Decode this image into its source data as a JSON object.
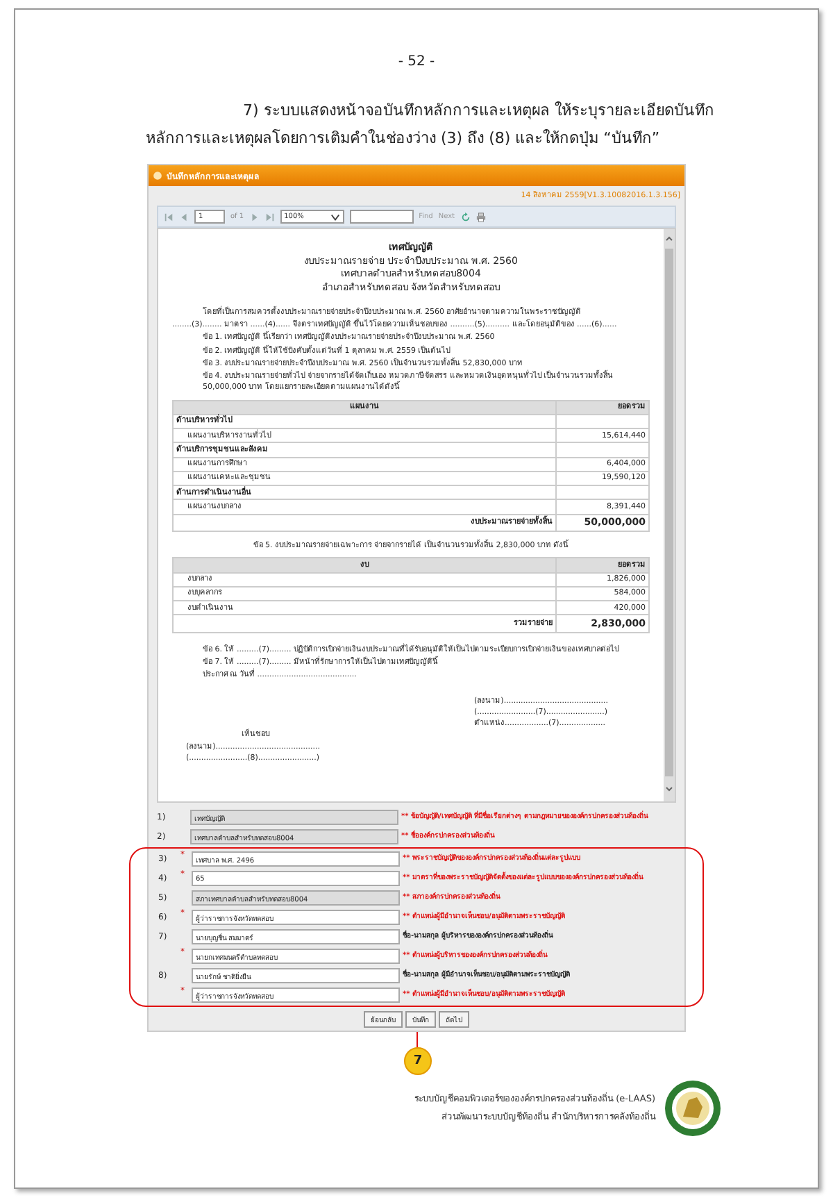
{
  "page_number": "- 52 -",
  "instruction": "7)  ระบบแสดงหน้าจอบันทึกหลักการและเหตุผล ให้ระบุรายละเอียดบันทึกหลักการและเหตุผลโดยการเติมคำในช่องว่าง (3) ถึง (8) และให้กดปุ่ม “บันทึก”",
  "panel": {
    "title": "บันทึกหลักการและเหตุผล",
    "version": "14 สิงหาคม 2559[V1.3.10082016.1.3.156]"
  },
  "viewer": {
    "page": "1",
    "of": "of 1",
    "zoom": "100%",
    "find": "Find",
    "next": "Next"
  },
  "report": {
    "title": "เทศบัญญัติ",
    "subtitles": [
      "งบประมาณรายจ่าย ประจำปีงบประมาณ พ.ศ. 2560",
      "เทศบาลตำบลสำหรับทดสอบ8004",
      "อำเภอสำหรับทดสอบ จังหวัดสำหรับทดสอบ"
    ],
    "preamble": "โดยที่เป็นการสมควรตั้งงบประมาณรายจ่ายประจำปีงบประมาณ พ.ศ. 2560 อาศัยอำนาจตามความในพระราชบัญญัติ",
    "blank_line": "........(3)........ มาตรา ......(4)...... จึงตราเทศบัญญัติ ขึ้นไว้โดยความเห็นชอบของ ..........(5).......... และโดยอนุมัติของ ......(6)......",
    "clauses": [
      "ข้อ 1. เทศบัญญัติ นี้เรียกว่า เทศบัญญัติงบประมาณรายจ่ายประจำปีงบประมาณ พ.ศ. 2560",
      "ข้อ 2. เทศบัญญัติ นี้ให้ใช้บังคับตั้งแต่วันที่ 1 ตุลาคม พ.ศ. 2559 เป็นต้นไป",
      "ข้อ 3. งบประมาณรายจ่ายประจำปีงบประมาณ พ.ศ. 2560 เป็นจำนวนรวมทั้งสิ้น 52,830,000 บาท",
      "ข้อ 4. งบประมาณรายจ่ายทั่วไป จ่ายจากรายได้จัดเก็บเอง หมวดภาษีจัดสรร และหมวดเงินอุดหนุนทั่วไป เป็นจำนวนรวมทั้งสิ้น 50,000,000 บาท โดยแยกรายละเอียดตามแผนงานได้ดังนี้"
    ],
    "tables": [
      {
        "columns": [
          "แผนงาน",
          "ยอดรวม"
        ],
        "rows": [
          {
            "kind": "section",
            "label": "ด้านบริหารทั่วไป"
          },
          {
            "kind": "item",
            "label": "แผนงานบริหารงานทั่วไป",
            "amount": "15,614,440"
          },
          {
            "kind": "section",
            "label": "ด้านบริการชุมชนและสังคม"
          },
          {
            "kind": "item",
            "label": "แผนงานการศึกษา",
            "amount": "6,404,000"
          },
          {
            "kind": "item",
            "label": "แผนงานเคหะและชุมชน",
            "amount": "19,590,120"
          },
          {
            "kind": "section",
            "label": "ด้านการดำเนินงานอื่น"
          },
          {
            "kind": "item",
            "label": "แผนงานงบกลาง",
            "amount": "8,391,440"
          },
          {
            "kind": "total",
            "label": "งบประมาณรายจ่ายทั้งสิ้น",
            "amount": "50,000,000"
          }
        ]
      },
      {
        "intro": "ข้อ 5. งบประมาณรายจ่ายเฉพาะการ จ่ายจากรายได้ เป็นจำนวนรวมทั้งสิ้น 2,830,000 บาท ดังนี้",
        "columns": [
          "งบ",
          "ยอดรวม"
        ],
        "rows": [
          {
            "kind": "item",
            "label": "งบกลาง",
            "amount": "1,826,000"
          },
          {
            "kind": "item",
            "label": "งบบุคลากร",
            "amount": "584,000"
          },
          {
            "kind": "item",
            "label": "งบดำเนินงาน",
            "amount": "420,000"
          },
          {
            "kind": "total",
            "label": "รวมรายจ่าย",
            "amount": "2,830,000"
          }
        ]
      }
    ],
    "closing": [
      "ข้อ 6. ให้ .........(7)......... ปฏิบัติการเบิกจ่ายเงินงบประมาณที่ได้รับอนุมัติให้เป็นไปตามระเบียบการเบิกจ่ายเงินของเทศบาลต่อไป",
      "ข้อ 7. ให้ .........(7)......... มีหน้าที่รักษาการให้เป็นไปตามเทศบัญญัตินี้",
      "ประกาศ ณ วันที่ ........................................."
    ],
    "sign_right": [
      "(ลงนาม)...........................................",
      "(........................(7)........................)",
      "ตำแหน่ง..................(7)..................."
    ],
    "sign_left": [
      "เห็นชอบ",
      "(ลงนาม)...........................................",
      "(........................(8)........................)"
    ]
  },
  "form_rows": [
    {
      "number": "1)",
      "readonly": true,
      "value": "เทศบัญญัติ",
      "kind": "note",
      "hint": "** ข้อบัญญัติ/เทศบัญญัติ ที่มีชื่อเรียกต่างๆ ตามกฎหมายขององค์กรปกครองส่วนท้องถิ่น"
    },
    {
      "number": "2)",
      "readonly": true,
      "value": "เทศบาลตำบลสำหรับทดสอบ8004",
      "kind": "note",
      "hint": "** ชื่อองค์กรปกครองส่วนท้องถิ่น"
    }
  ],
  "highlight_group": {
    "rows": [
      {
        "number": "3)",
        "asterisk": "*",
        "readonly": false,
        "value": "เทศบาล พ.ศ. 2496",
        "kind": "note",
        "hint": "** พระราชบัญญัติขององค์กรปกครองส่วนท้องถิ่นแต่ละรูปแบบ"
      },
      {
        "number": "4)",
        "asterisk": "*",
        "readonly": false,
        "value": "65",
        "kind": "note",
        "hint": "** มาตราที่ของพระราชบัญญัติจัดตั้งของแต่ละรูปแบบขององค์กรปกครองส่วนท้องถิ่น"
      },
      {
        "number": "5)",
        "readonly": true,
        "value": "สภาเทศบาลตำบลสำหรับทดสอบ8004",
        "kind": "note",
        "hint": "** สภาองค์กรปกครองส่วนท้องถิ่น"
      },
      {
        "number": "6)",
        "asterisk": "*",
        "readonly": false,
        "value": "ผู้ว่าราชการจังหวัดทดสอบ",
        "kind": "note",
        "hint": "** ตำแหน่งผู้มีอำนาจเห็นชอบ/อนุมัติตามพระราชบัญญัติ"
      },
      {
        "number": "7)",
        "readonly": false,
        "value": "นายบุญชื่น  สมมาตร์",
        "kind": "info",
        "hint": "ชื่อ-นามสกุล ผู้บริหารขององค์กรปกครองส่วนท้องถิ่น"
      },
      {
        "asterisk": "*",
        "readonly": false,
        "value": "นายกเทศมนตรีตำบลทดสอบ",
        "kind": "note",
        "hint": "** ตำแหน่งผู้บริหารขององค์กรปกครองส่วนท้องถิ่น"
      },
      {
        "number": "8)",
        "readonly": false,
        "value": "นายรักษ์ ชาติยิ่งยืน",
        "kind": "info",
        "hint": "ชื่อ-นามสกุล ผู้มีอำนาจเห็นชอบ/อนุมัติตามพระราชบัญญัติ"
      },
      {
        "asterisk": "*",
        "readonly": false,
        "value": "ผู้ว่าราชการจังหวัดทดสอบ",
        "kind": "note",
        "hint": "** ตำแหน่งผู้มีอำนาจเห็นชอบ/อนุมัติตามพระราชบัญญัติ"
      }
    ]
  },
  "buttons": [
    {
      "label": "ย้อนกลับ"
    },
    {
      "label": "บันทึก"
    },
    {
      "label": "ถัดไป"
    }
  ],
  "callout": {
    "number": "7"
  },
  "footer": [
    "ระบบบัญชีคอมพิวเตอร์ขององค์กรปกครองส่วนท้องถิ่น (e-LAAS)",
    "ส่วนพัฒนาระบบบัญชีท้องถิ่น   สำนักบริหารการคลังท้องถิ่น"
  ]
}
